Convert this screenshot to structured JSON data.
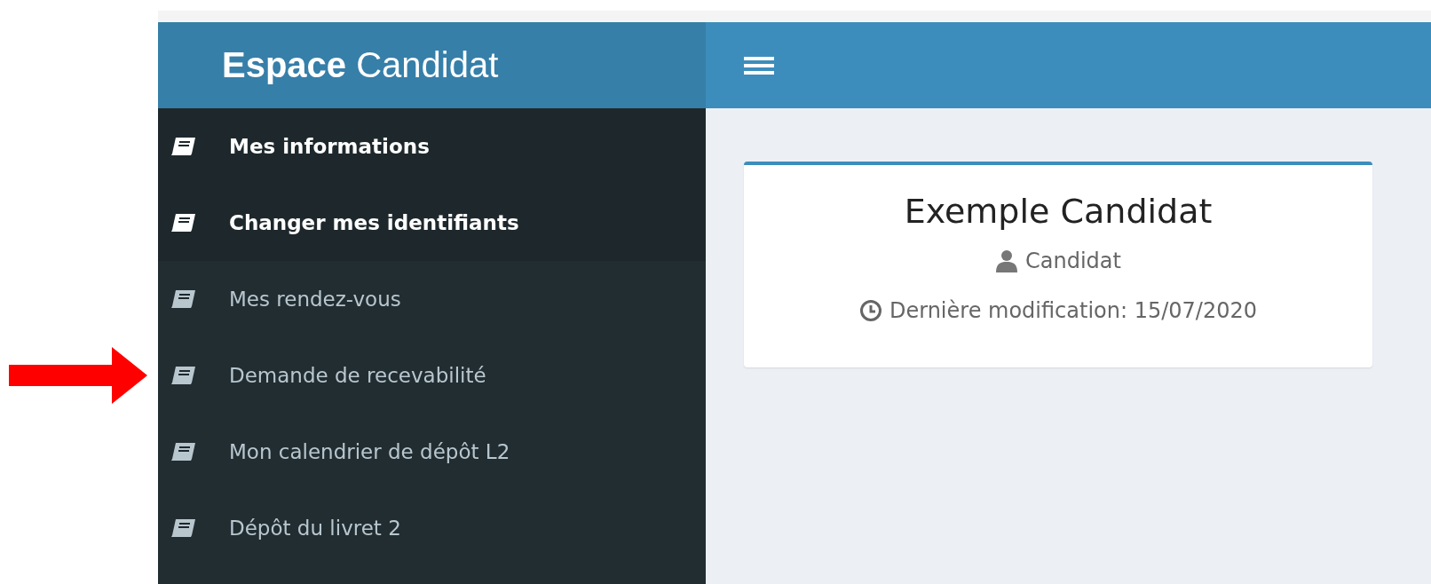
{
  "header": {
    "brand": "**Espace** Candidat"
  },
  "sidebar": {
    "items": [
      {
        "label": "Mes informations",
        "highlighted": true
      },
      {
        "label": "Changer mes identifiants",
        "highlighted": true
      },
      {
        "label": "Mes rendez-vous",
        "highlighted": false
      },
      {
        "label": "Demande de recevabilité",
        "highlighted": false
      },
      {
        "label": "Mon calendrier de dépôt L2",
        "highlighted": false
      },
      {
        "label": "Dépôt du livret 2",
        "highlighted": false
      }
    ]
  },
  "profile": {
    "name": "Exemple Candidat",
    "role": "Candidat",
    "modified": "Dernière modification: 15/07/2020"
  }
}
